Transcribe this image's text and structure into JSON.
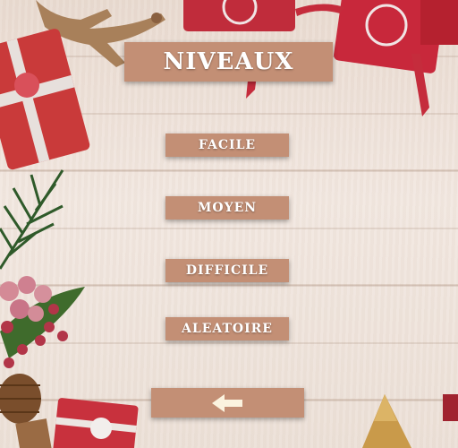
{
  "title": "NIVEAUX",
  "levels": [
    {
      "label": "FACILE"
    },
    {
      "label": "MOYEN"
    },
    {
      "label": "DIFFICILE"
    },
    {
      "label": "ALEATOIRE"
    }
  ],
  "back_button": {
    "icon": "arrow-left-icon"
  },
  "colors": {
    "button": "#c38f75",
    "text": "#ffffff",
    "gift_red": "#c0283a",
    "wood": "#eee2d8"
  }
}
